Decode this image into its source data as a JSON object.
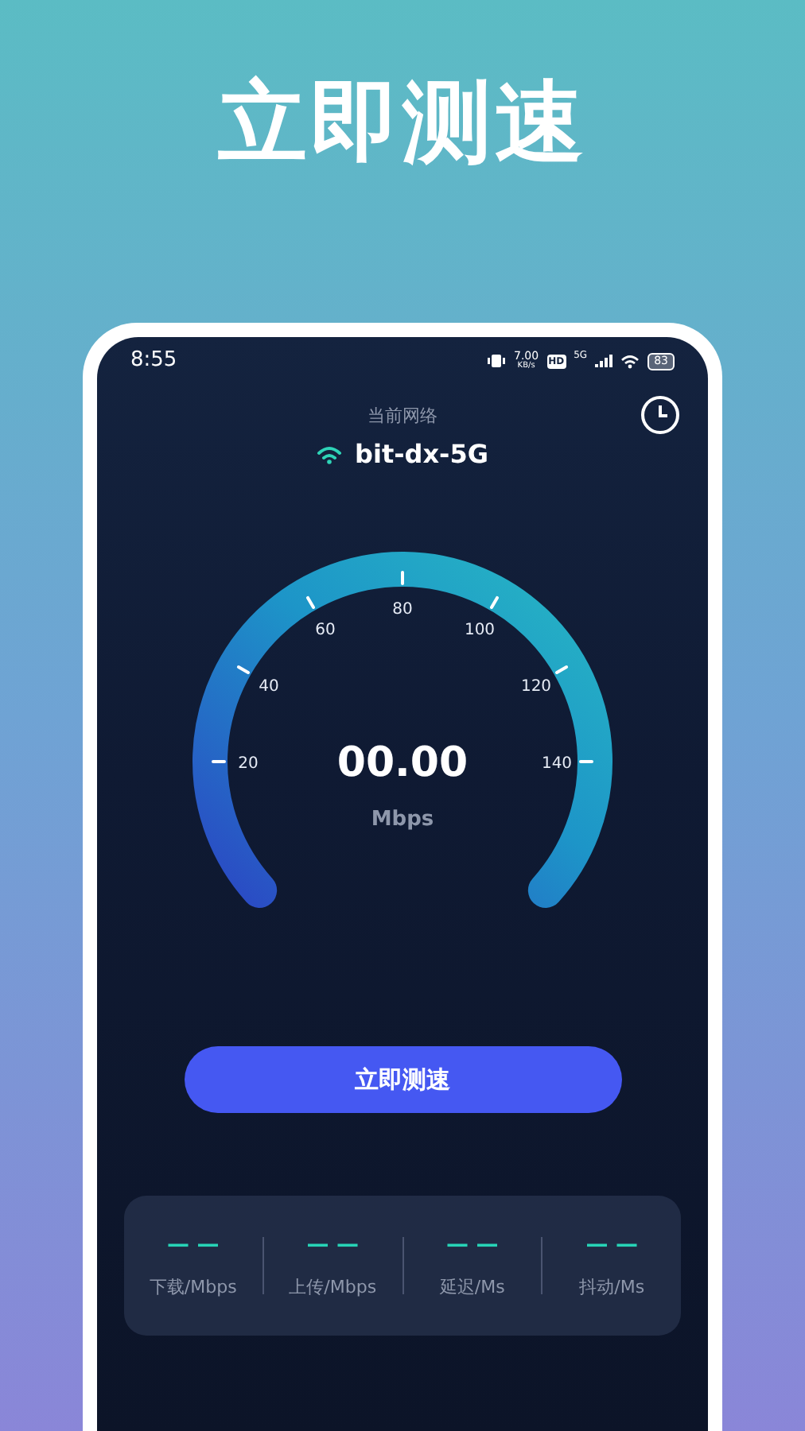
{
  "headline": "立即测速",
  "status_bar": {
    "time": "8:55",
    "net_speed": "7.00",
    "net_speed_unit": "KB/s",
    "hd": "HD",
    "signal": "5G",
    "battery": "83"
  },
  "network": {
    "label": "当前网络",
    "name": "bit-dx-5G"
  },
  "gauge": {
    "ticks": [
      "20",
      "40",
      "60",
      "80",
      "100",
      "120",
      "140"
    ],
    "reading": "00.00",
    "unit": "Mbps"
  },
  "start_button": "立即测速",
  "stats": [
    {
      "value": "— —",
      "label": "下载/Mbps"
    },
    {
      "value": "— —",
      "label": "上传/Mbps"
    },
    {
      "value": "— —",
      "label": "延迟/Ms"
    },
    {
      "value": "— —",
      "label": "抖动/Ms"
    }
  ]
}
